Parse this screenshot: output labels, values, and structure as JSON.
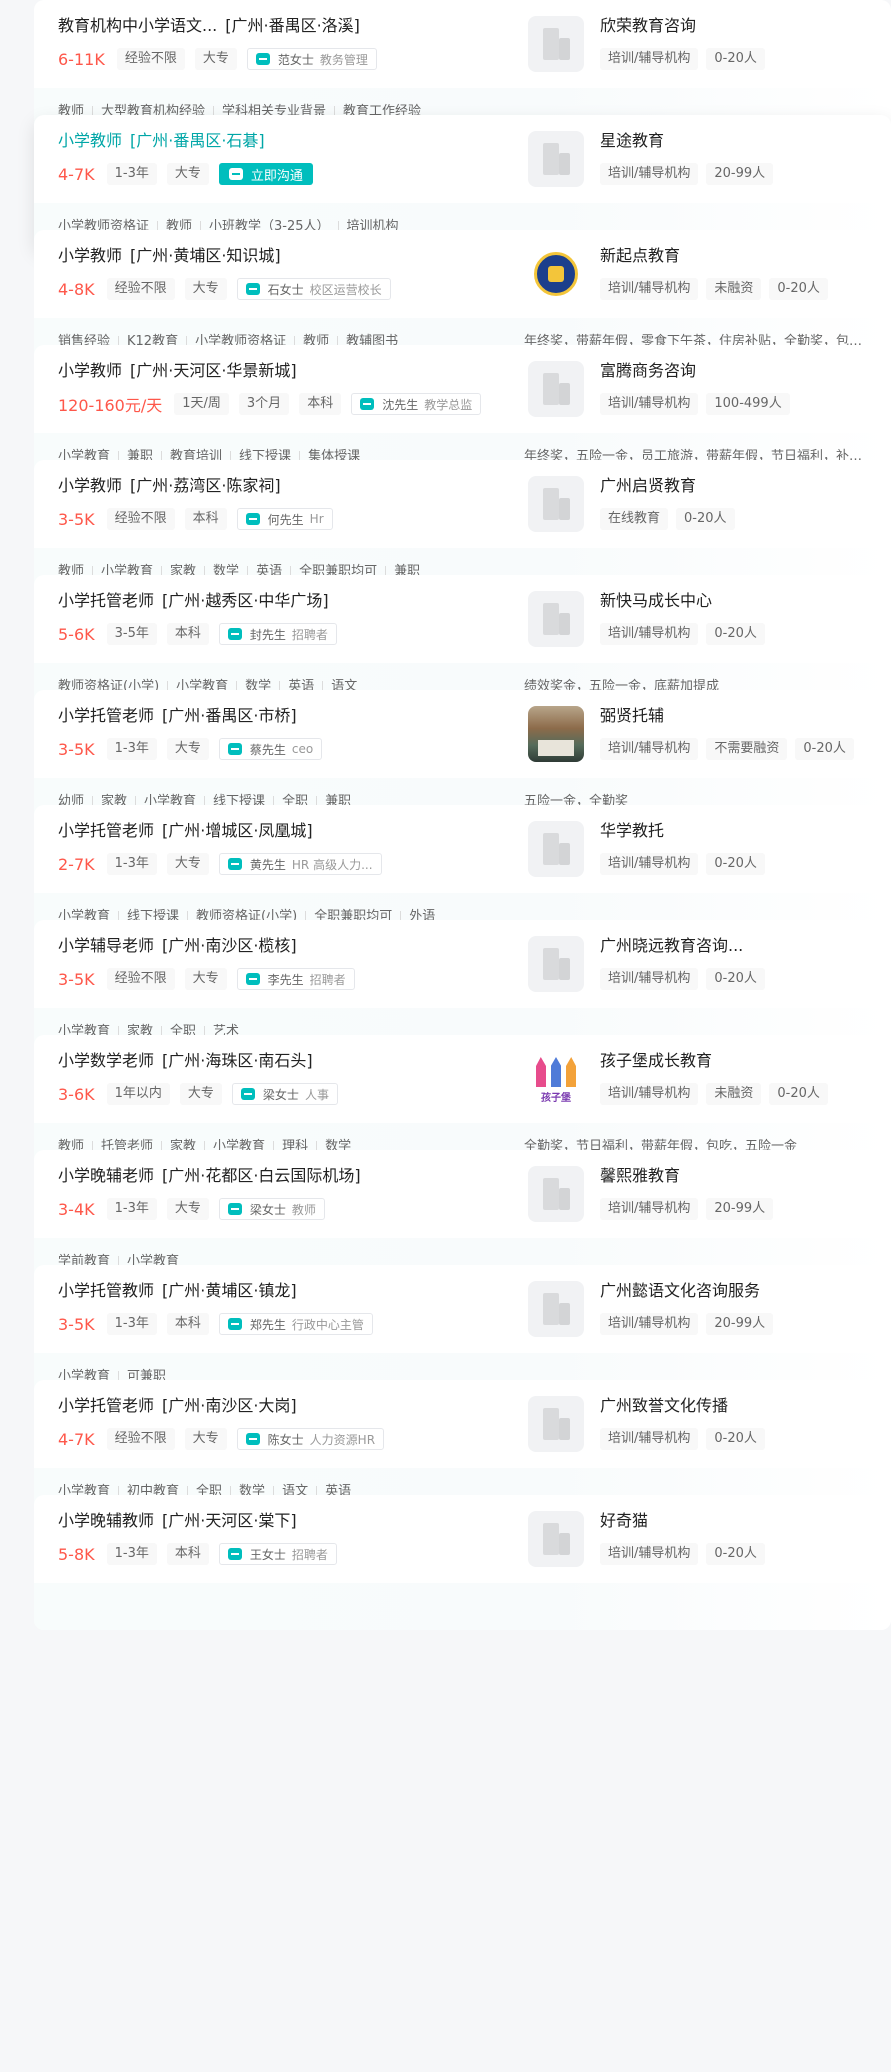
{
  "jobs": [
    {
      "title": "教育机构中小学语文...",
      "area": "[广州·番禺区·洛溪]",
      "salary": "6-11K",
      "tags": [
        "经验不限",
        "大专"
      ],
      "boss_name": "范女士",
      "boss_title": "教务管理",
      "chat_label": "",
      "company": "欣荣教育咨询",
      "company_tags": [
        "培训/辅导机构",
        "0-20人"
      ],
      "logo": "building-icon",
      "skills": [
        "教师",
        "大型教育机构经验",
        "学科相关专业背景",
        "教育工作经验"
      ],
      "welfare": ""
    },
    {
      "title": "小学教师",
      "area": "[广州·番禺区·石碁]",
      "salary": "4-7K",
      "tags": [
        "1-3年",
        "大专"
      ],
      "boss_name": "",
      "boss_title": "",
      "chat_label": "立即沟通",
      "company": "星途教育",
      "company_tags": [
        "培训/辅导机构",
        "20-99人"
      ],
      "logo": "building-icon",
      "skills": [
        "小学教师资格证",
        "教师",
        "小班教学（3-25人）",
        "培训机构"
      ],
      "welfare": ""
    },
    {
      "title": "小学教师",
      "area": "[广州·黄埔区·知识城]",
      "salary": "4-8K",
      "tags": [
        "经验不限",
        "大专"
      ],
      "boss_name": "石女士",
      "boss_title": "校区运营校长",
      "chat_label": "",
      "company": "新起点教育",
      "company_tags": [
        "培训/辅导机构",
        "未融资",
        "0-20人"
      ],
      "logo": "emblem-logo",
      "skills": [
        "销售经验",
        "K12教育",
        "小学教师资格证",
        "教师",
        "教辅图书"
      ],
      "welfare": "年终奖，带薪年假，零食下午茶，住房补贴，全勤奖，包吃..."
    },
    {
      "title": "小学教师",
      "area": "[广州·天河区·华景新城]",
      "salary": "120-160元/天",
      "tags": [
        "1天/周",
        "3个月",
        "本科"
      ],
      "boss_name": "沈先生",
      "boss_title": "教学总监",
      "chat_label": "",
      "company": "富腾商务咨询",
      "company_tags": [
        "培训/辅导机构",
        "100-499人"
      ],
      "logo": "building-icon",
      "skills": [
        "小学教育",
        "兼职",
        "教育培训",
        "线下授课",
        "集体授课"
      ],
      "welfare": "年终奖，五险一金，员工旅游，带薪年假，节日福利，补充..."
    },
    {
      "title": "小学教师",
      "area": "[广州·荔湾区·陈家祠]",
      "salary": "3-5K",
      "tags": [
        "经验不限",
        "本科"
      ],
      "boss_name": "何先生",
      "boss_title": "Hr",
      "chat_label": "",
      "company": "广州启贤教育",
      "company_tags": [
        "在线教育",
        "0-20人"
      ],
      "logo": "building-icon",
      "skills": [
        "教师",
        "小学教育",
        "家教",
        "数学",
        "英语",
        "全职兼职均可",
        "兼职"
      ],
      "welfare": ""
    },
    {
      "title": "小学托管老师",
      "area": "[广州·越秀区·中华广场]",
      "salary": "5-6K",
      "tags": [
        "3-5年",
        "本科"
      ],
      "boss_name": "封先生",
      "boss_title": "招聘者",
      "chat_label": "",
      "company": "新快马成长中心",
      "company_tags": [
        "培训/辅导机构",
        "0-20人"
      ],
      "logo": "building-icon",
      "skills": [
        "教师资格证(小学)",
        "小学教育",
        "数学",
        "英语",
        "语文"
      ],
      "welfare": "绩效奖金，五险一金，底薪加提成"
    },
    {
      "title": "小学托管老师",
      "area": "[广州·番禺区·市桥]",
      "salary": "3-5K",
      "tags": [
        "1-3年",
        "大专"
      ],
      "boss_name": "蔡先生",
      "boss_title": "ceo",
      "chat_label": "",
      "company": "弼贤托辅",
      "company_tags": [
        "培训/辅导机构",
        "不需要融资",
        "0-20人"
      ],
      "logo": "photo-logo",
      "skills": [
        "幼师",
        "家教",
        "小学教育",
        "线下授课",
        "全职",
        "兼职"
      ],
      "welfare": "五险一金，全勤奖"
    },
    {
      "title": "小学托管老师",
      "area": "[广州·增城区·凤凰城]",
      "salary": "2-7K",
      "tags": [
        "1-3年",
        "大专"
      ],
      "boss_name": "黄先生",
      "boss_title": "HR 高级人力...",
      "chat_label": "",
      "company": "华学教托",
      "company_tags": [
        "培训/辅导机构",
        "0-20人"
      ],
      "logo": "building-icon",
      "skills": [
        "小学教育",
        "线下授课",
        "教师资格证(小学)",
        "全职兼职均可",
        "外语"
      ],
      "welfare": ""
    },
    {
      "title": "小学辅导老师",
      "area": "[广州·南沙区·榄核]",
      "salary": "3-5K",
      "tags": [
        "经验不限",
        "大专"
      ],
      "boss_name": "李先生",
      "boss_title": "招聘者",
      "chat_label": "",
      "company": "广州晓远教育咨询...",
      "company_tags": [
        "培训/辅导机构",
        "0-20人"
      ],
      "logo": "building-icon",
      "skills": [
        "小学教育",
        "家教",
        "全职",
        "艺术"
      ],
      "welfare": ""
    },
    {
      "title": "小学数学老师",
      "area": "[广州·海珠区·南石头]",
      "salary": "3-6K",
      "tags": [
        "1年以内",
        "大专"
      ],
      "boss_name": "梁女士",
      "boss_title": "人事",
      "chat_label": "",
      "company": "孩子堡成长教育",
      "company_tags": [
        "培训/辅导机构",
        "未融资",
        "0-20人"
      ],
      "logo": "castle-logo",
      "logo_text": "孩子堡",
      "skills": [
        "教师",
        "托管老师",
        "家教",
        "小学教育",
        "理科",
        "数学"
      ],
      "welfare": "全勤奖，节日福利，带薪年假，包吃，五险一金"
    },
    {
      "title": "小学晚辅老师",
      "area": "[广州·花都区·白云国际机场]",
      "salary": "3-4K",
      "tags": [
        "1-3年",
        "大专"
      ],
      "boss_name": "梁女士",
      "boss_title": "教师",
      "chat_label": "",
      "company": "馨熙雅教育",
      "company_tags": [
        "培训/辅导机构",
        "20-99人"
      ],
      "logo": "building-icon",
      "skills": [
        "学前教育",
        "小学教育"
      ],
      "welfare": ""
    },
    {
      "title": "小学托管教师",
      "area": "[广州·黄埔区·镇龙]",
      "salary": "3-5K",
      "tags": [
        "1-3年",
        "本科"
      ],
      "boss_name": "郑先生",
      "boss_title": "行政中心主管",
      "chat_label": "",
      "company": "广州懿语文化咨询服务",
      "company_tags": [
        "培训/辅导机构",
        "20-99人"
      ],
      "logo": "building-icon",
      "skills": [
        "小学教育",
        "可兼职"
      ],
      "welfare": ""
    },
    {
      "title": "小学托管老师",
      "area": "[广州·南沙区·大岗]",
      "salary": "4-7K",
      "tags": [
        "经验不限",
        "大专"
      ],
      "boss_name": "陈女士",
      "boss_title": "人力资源HR",
      "chat_label": "",
      "company": "广州致誉文化传播",
      "company_tags": [
        "培训/辅导机构",
        "0-20人"
      ],
      "logo": "building-icon",
      "skills": [
        "小学教育",
        "初中教育",
        "全职",
        "数学",
        "语文",
        "英语"
      ],
      "welfare": ""
    },
    {
      "title": "小学晚辅教师",
      "area": "[广州·天河区·棠下]",
      "salary": "5-8K",
      "tags": [
        "1-3年",
        "本科"
      ],
      "boss_name": "王女士",
      "boss_title": "招聘者",
      "chat_label": "",
      "company": "好奇猫",
      "company_tags": [
        "培训/辅导机构",
        "0-20人"
      ],
      "logo": "building-icon",
      "skills": [],
      "welfare": ""
    }
  ],
  "theme": {
    "accent": "#00bebd",
    "salary": "#fe574a",
    "active_title": "#00a6a7"
  }
}
